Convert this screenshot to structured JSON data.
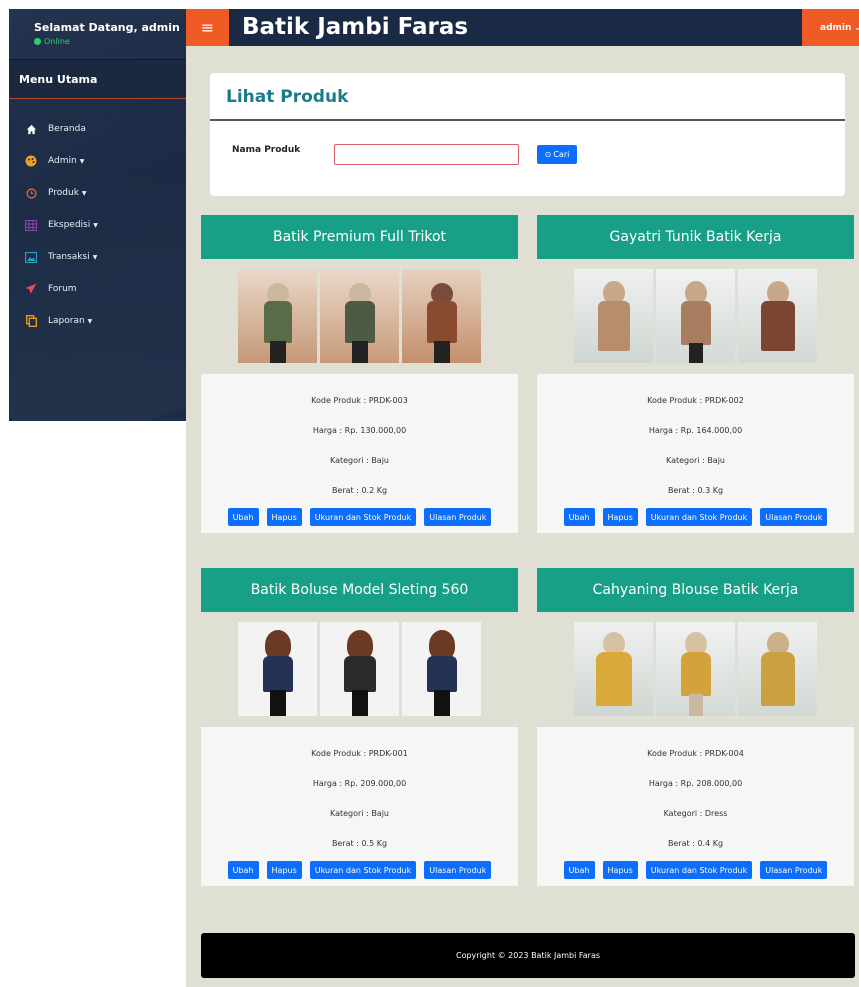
{
  "sidebar": {
    "welcome": "Selamat Datang, admin",
    "status": "Online",
    "menu_header": "Menu Utama",
    "items": [
      {
        "label": "Beranda",
        "icon": "home-icon",
        "color": "#ffffff"
      },
      {
        "label": "Admin",
        "icon": "palette-icon",
        "color": "#f0a020"
      },
      {
        "label": "Produk",
        "icon": "clock-icon",
        "color": "#f05a24"
      },
      {
        "label": "Ekspedisi",
        "icon": "grid-icon",
        "color": "#8e44ad"
      },
      {
        "label": "Transaksi",
        "icon": "image-icon",
        "color": "#2aa1c0"
      },
      {
        "label": "Forum",
        "icon": "paper-plane-icon",
        "color": "#e74c5c"
      },
      {
        "label": "Laporan",
        "icon": "copy-icon",
        "color": "#f0a020"
      }
    ]
  },
  "topbar": {
    "brand": "Batik Jambi Faras",
    "user": "admin"
  },
  "panel": {
    "title": "Lihat Produk",
    "field_label": "Nama Produk",
    "search_value": "",
    "search_button": "Cari"
  },
  "products": [
    {
      "name": "Batik Premium Full Trikot",
      "code": "Kode Produk : PRDK-003",
      "price": "Harga : Rp. 130.000,00",
      "category": "Kategori : Baju",
      "weight": "Berat : 0.2 Kg"
    },
    {
      "name": "Gayatri Tunik Batik Kerja",
      "code": "Kode Produk : PRDK-002",
      "price": "Harga : Rp. 164.000,00",
      "category": "Kategori : Baju",
      "weight": "Berat : 0.3 Kg"
    },
    {
      "name": "Batik Boluse Model Sleting 560",
      "code": "Kode Produk : PRDK-001",
      "price": "Harga : Rp. 209.000,00",
      "category": "Kategori : Baju",
      "weight": "Berat : 0.5 Kg"
    },
    {
      "name": "Cahyaning Blouse Batik Kerja",
      "code": "Kode Produk : PRDK-004",
      "price": "Harga : Rp. 208.000,00",
      "category": "Kategori : Dress",
      "weight": "Berat : 0.4 Kg"
    }
  ],
  "actions": {
    "edit": "Ubah",
    "delete": "Hapus",
    "stock": "Ukuran dan Stok Produk",
    "reviews": "Ulasan Produk"
  },
  "footer": "Copyright © 2023 Batik Jambi Faras",
  "colors": {
    "accent": "#f05a24",
    "header_teal": "#17a085",
    "primary_button": "#0d6efd",
    "navbar": "#1a2a44"
  }
}
